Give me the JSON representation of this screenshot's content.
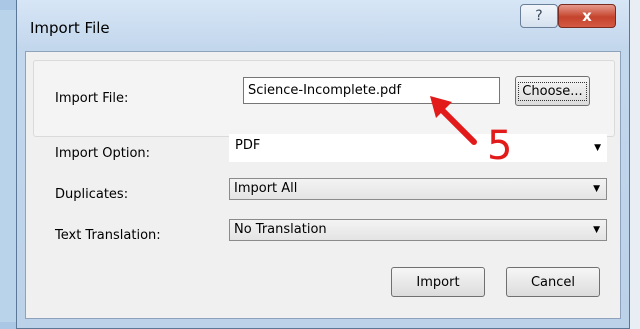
{
  "window": {
    "title": "Import File",
    "help_label": "?",
    "close_label": "x"
  },
  "form": {
    "import_file_label": "Import File:",
    "import_file_value": "Science-Incomplete.pdf",
    "choose_label": "Choose...",
    "import_option_label": "Import Option:",
    "import_option_value": "PDF",
    "duplicates_label": "Duplicates:",
    "duplicates_value": "Import All",
    "text_translation_label": "Text Translation:",
    "text_translation_value": "No Translation"
  },
  "buttons": {
    "import_label": "Import",
    "cancel_label": "Cancel"
  },
  "annotation": {
    "step_number": "5",
    "color": "#e21a1a"
  },
  "icons": {
    "dropdown": "chevron-down-icon",
    "arrow": "red-arrow-icon"
  }
}
